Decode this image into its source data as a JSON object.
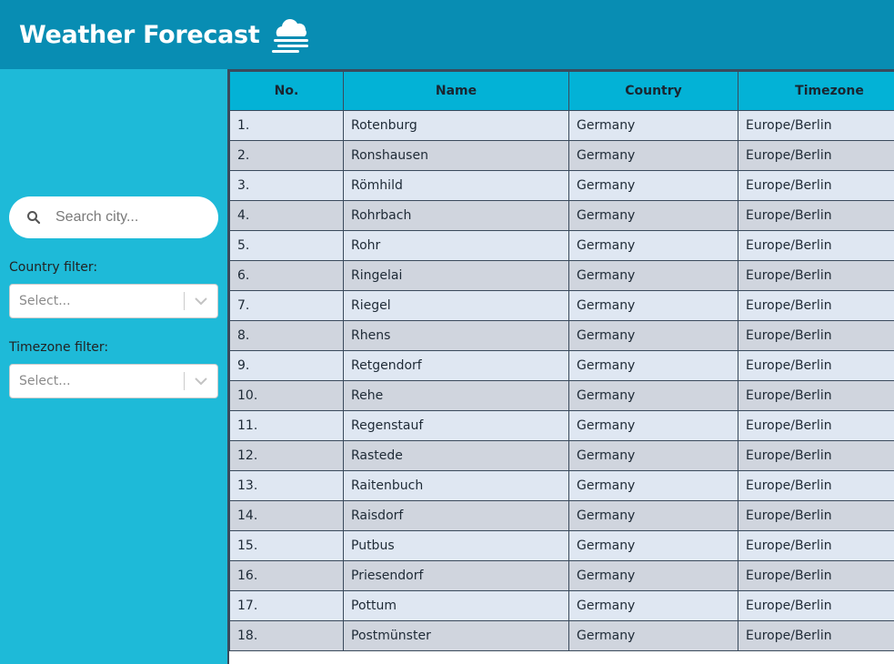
{
  "header": {
    "title": "Weather Forecast",
    "logo_icon": "cloud-fog-icon",
    "background": "#088db3"
  },
  "sidebar": {
    "search": {
      "placeholder": "Search city...",
      "value": "",
      "icon": "search-icon"
    },
    "country_filter": {
      "label": "Country filter:",
      "value": "Select..."
    },
    "timezone_filter": {
      "label": "Timezone filter:",
      "value": "Select..."
    },
    "background": "#1ebad8"
  },
  "table": {
    "columns": [
      "No.",
      "Name",
      "Country",
      "Timezone"
    ],
    "rows": [
      [
        "1.",
        "Rotenburg",
        "Germany",
        "Europe/Berlin"
      ],
      [
        "2.",
        "Ronshausen",
        "Germany",
        "Europe/Berlin"
      ],
      [
        "3.",
        "Römhild",
        "Germany",
        "Europe/Berlin"
      ],
      [
        "4.",
        "Rohrbach",
        "Germany",
        "Europe/Berlin"
      ],
      [
        "5.",
        "Rohr",
        "Germany",
        "Europe/Berlin"
      ],
      [
        "6.",
        "Ringelai",
        "Germany",
        "Europe/Berlin"
      ],
      [
        "7.",
        "Riegel",
        "Germany",
        "Europe/Berlin"
      ],
      [
        "8.",
        "Rhens",
        "Germany",
        "Europe/Berlin"
      ],
      [
        "9.",
        "Retgendorf",
        "Germany",
        "Europe/Berlin"
      ],
      [
        "10.",
        "Rehe",
        "Germany",
        "Europe/Berlin"
      ],
      [
        "11.",
        "Regenstauf",
        "Germany",
        "Europe/Berlin"
      ],
      [
        "12.",
        "Rastede",
        "Germany",
        "Europe/Berlin"
      ],
      [
        "13.",
        "Raitenbuch",
        "Germany",
        "Europe/Berlin"
      ],
      [
        "14.",
        "Raisdorf",
        "Germany",
        "Europe/Berlin"
      ],
      [
        "15.",
        "Putbus",
        "Germany",
        "Europe/Berlin"
      ],
      [
        "16.",
        "Priesendorf",
        "Germany",
        "Europe/Berlin"
      ],
      [
        "17.",
        "Pottum",
        "Germany",
        "Europe/Berlin"
      ],
      [
        "18.",
        "Postmünster",
        "Germany",
        "Europe/Berlin"
      ]
    ],
    "header_color": "#03b2d6",
    "row_colors": [
      "#dfe7f2",
      "#d0d5de"
    ]
  }
}
